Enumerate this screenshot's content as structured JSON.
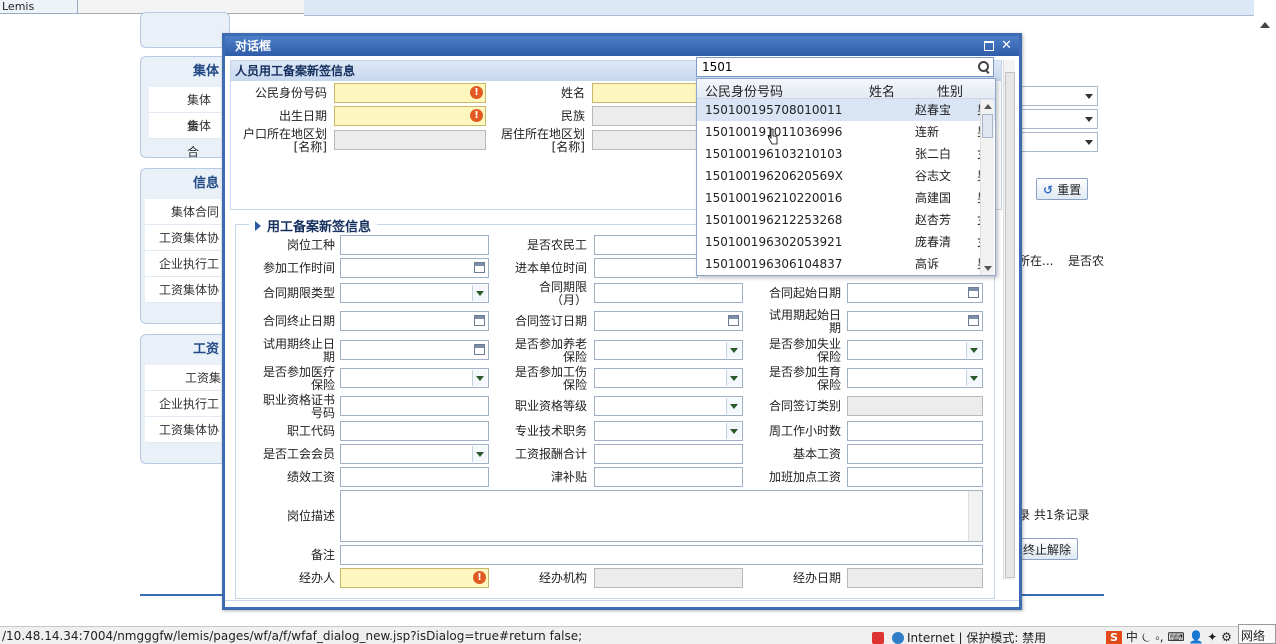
{
  "browser": {
    "tab_label": "Lemis",
    "status_url": "/10.48.14.34:7004/nmgggfw/lemis/pages/wf/a/f/wfaf_dialog_new.jsp?isDialog=true#return false;",
    "zone": "Internet | 保护模式: 禁用",
    "tray_text": "中 ⏾ ⸰, ⌨ 👤 ✦ ⚙",
    "network": "网络"
  },
  "background": {
    "panel1": {
      "title": "集体",
      "items": [
        "集体合",
        "集体合"
      ]
    },
    "panel2": {
      "title": "信息",
      "items": [
        "集体合同",
        "工资集体协",
        "企业执行工",
        "工资集体协"
      ]
    },
    "panel3": {
      "title": "工资",
      "items": [
        "工资集",
        "企业执行工",
        "工资集体协"
      ]
    },
    "reset_button": "重置",
    "grid_headers": [
      "所在...",
      "是否农"
    ],
    "record_count": "录 共1条记录",
    "terminate_button": "终止解除"
  },
  "dialog": {
    "title": "对话框",
    "section1": {
      "title": "人员用工备案新签信息",
      "id_label": "公民身份号码",
      "name_label": "姓名",
      "birth_label": "出生日期",
      "ethnic_label": "民族",
      "hukou_label_1": "户口所在地区划",
      "hukou_label_2": "[名称]",
      "residence_label_1": "居住所在地区划",
      "residence_label_2": "[名称]"
    },
    "section2": {
      "title": "用工备案新签信息",
      "fields": {
        "post": "岗位工种",
        "is_farmer": "是否农民工",
        "work_start": "参加工作时间",
        "join_time": "进本单位时间",
        "contract_type": "合同期限类型",
        "contract_months_1": "合同期限",
        "contract_months_2": "（月）",
        "contract_start": "合同起始日期",
        "contract_end": "合同终止日期",
        "contract_sign": "合同签订日期",
        "probation_start_1": "试用期起始日",
        "probation_start_2": "期",
        "probation_end_1": "试用期终止日",
        "probation_end_2": "期",
        "pension_1": "是否参加养老",
        "pension_2": "保险",
        "unemployment_1": "是否参加失业",
        "unemployment_2": "保险",
        "medical_1": "是否参加医疗",
        "medical_2": "保险",
        "injury_1": "是否参加工伤",
        "injury_2": "保险",
        "maternity_1": "是否参加生育",
        "maternity_2": "保险",
        "cert_no_1": "职业资格证书",
        "cert_no_2": "号码",
        "cert_level": "职业资格等级",
        "contract_category": "合同签订类别",
        "job_code": "职工代码",
        "tech_post": "专业技术职务",
        "weekly_hours": "周工作小时数",
        "union": "是否工会会员",
        "wage_total": "工资报酬合计",
        "base_wage": "基本工资",
        "perf_wage": "绩效工资",
        "allowance": "津补贴",
        "overtime": "加班加点工资",
        "job_desc": "岗位描述",
        "remark": "备注",
        "handler": "经办人",
        "handling_org": "经办机构",
        "handling_date": "经办日期"
      }
    }
  },
  "id_lookup": {
    "query": "1501",
    "columns": [
      "公民身份号码",
      "姓名",
      "性别"
    ],
    "rows": [
      {
        "id": "150100195708010011",
        "name": "赵春宝",
        "sex": "男"
      },
      {
        "id": "150100191011036996",
        "name": "连新",
        "sex": "男"
      },
      {
        "id": "150100196103210103",
        "name": "张二白",
        "sex": "女"
      },
      {
        "id": "15010019620620569X",
        "name": "谷志文",
        "sex": "男"
      },
      {
        "id": "150100196210220016",
        "name": "高建国",
        "sex": "男"
      },
      {
        "id": "150100196212253268",
        "name": "赵杏芳",
        "sex": "女"
      },
      {
        "id": "150100196302053921",
        "name": "庞春清",
        "sex": "女"
      },
      {
        "id": "150100196306104837",
        "name": "高诉",
        "sex": "男"
      }
    ],
    "selected_index": 0
  }
}
